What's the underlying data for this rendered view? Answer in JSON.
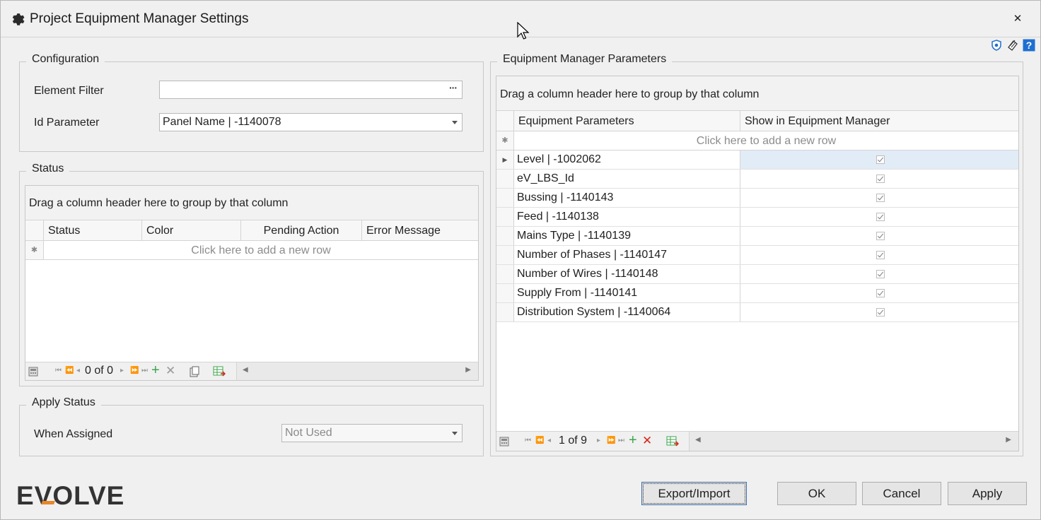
{
  "window": {
    "title": "Project Equipment Manager Settings",
    "close_glyph": "✕"
  },
  "configuration": {
    "group_label": "Configuration",
    "element_filter_label": "Element Filter",
    "element_filter_value": "",
    "element_filter_button": "···",
    "id_parameter_label": "Id Parameter",
    "id_parameter_value": "Panel Name | -1140078"
  },
  "status": {
    "group_label": "Status",
    "group_panel_text": "Drag a column header here to group by that column",
    "columns": [
      "Status",
      "Color",
      "Pending Action",
      "Error Message"
    ],
    "new_row_text": "Click here to add a new row",
    "record_text": "0 of 0"
  },
  "apply_status": {
    "group_label": "Apply Status",
    "when_assigned_label": "When Assigned",
    "when_assigned_value": "Not Used"
  },
  "parameters": {
    "group_label": "Equipment Manager Parameters",
    "group_panel_text": "Drag a column header here to group by that column",
    "columns": [
      "Equipment Parameters",
      "Show in Equipment Manager"
    ],
    "new_row_text": "Click here to add a new row",
    "rows": [
      {
        "name": "Level | -1002062",
        "show": true
      },
      {
        "name": "eV_LBS_Id",
        "show": true
      },
      {
        "name": "Bussing | -1140143",
        "show": true
      },
      {
        "name": "Feed | -1140138",
        "show": true
      },
      {
        "name": "Mains Type | -1140139",
        "show": true
      },
      {
        "name": "Number of Phases | -1140147",
        "show": true
      },
      {
        "name": "Number of Wires | -1140148",
        "show": true
      },
      {
        "name": "Supply From | -1140141",
        "show": true
      },
      {
        "name": "Distribution System | -1140064",
        "show": true
      }
    ],
    "selected_row": 0,
    "record_text": "1 of 9"
  },
  "buttons": {
    "export_import": "Export/Import",
    "ok": "OK",
    "cancel": "Cancel",
    "apply": "Apply"
  },
  "logo": {
    "text": "EVOLVE"
  },
  "icons": {
    "title": "gear-icon",
    "top_right": [
      "shield-icon",
      "eraser-icon",
      "help-icon"
    ]
  },
  "colors": {
    "selected_cell": "#e1ecf7",
    "add_green": "#3fa34d",
    "delete_red": "#d9261c",
    "help_blue": "#1f6fd1",
    "logo_orange": "#e8862a"
  }
}
